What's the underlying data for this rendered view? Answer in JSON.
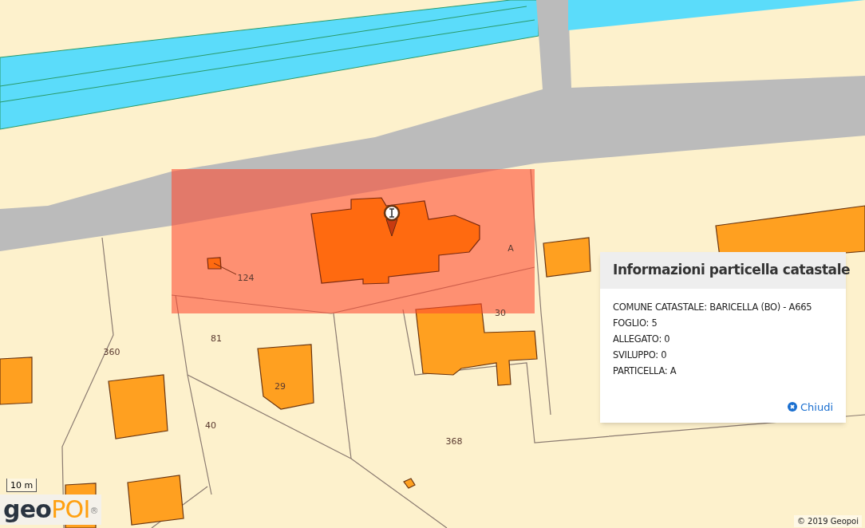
{
  "map": {
    "parcel_labels": [
      "124",
      "A",
      "30",
      "81",
      "360",
      "29",
      "40",
      "368"
    ],
    "scale_bar": "10 m",
    "logo": {
      "dark": "geo",
      "accent": "POI",
      "mark": "®"
    },
    "attribution": "© 2019 Geopoi"
  },
  "popup": {
    "title": "Informazioni particella catastale",
    "lines": [
      "COMUNE CATASTALE: BARICELLA (BO) - A665",
      "FOGLIO: 5",
      "ALLEGATO: 0",
      "SVILUPPO: 0",
      "PARTICELLA: A"
    ],
    "close": "Chiudi"
  }
}
